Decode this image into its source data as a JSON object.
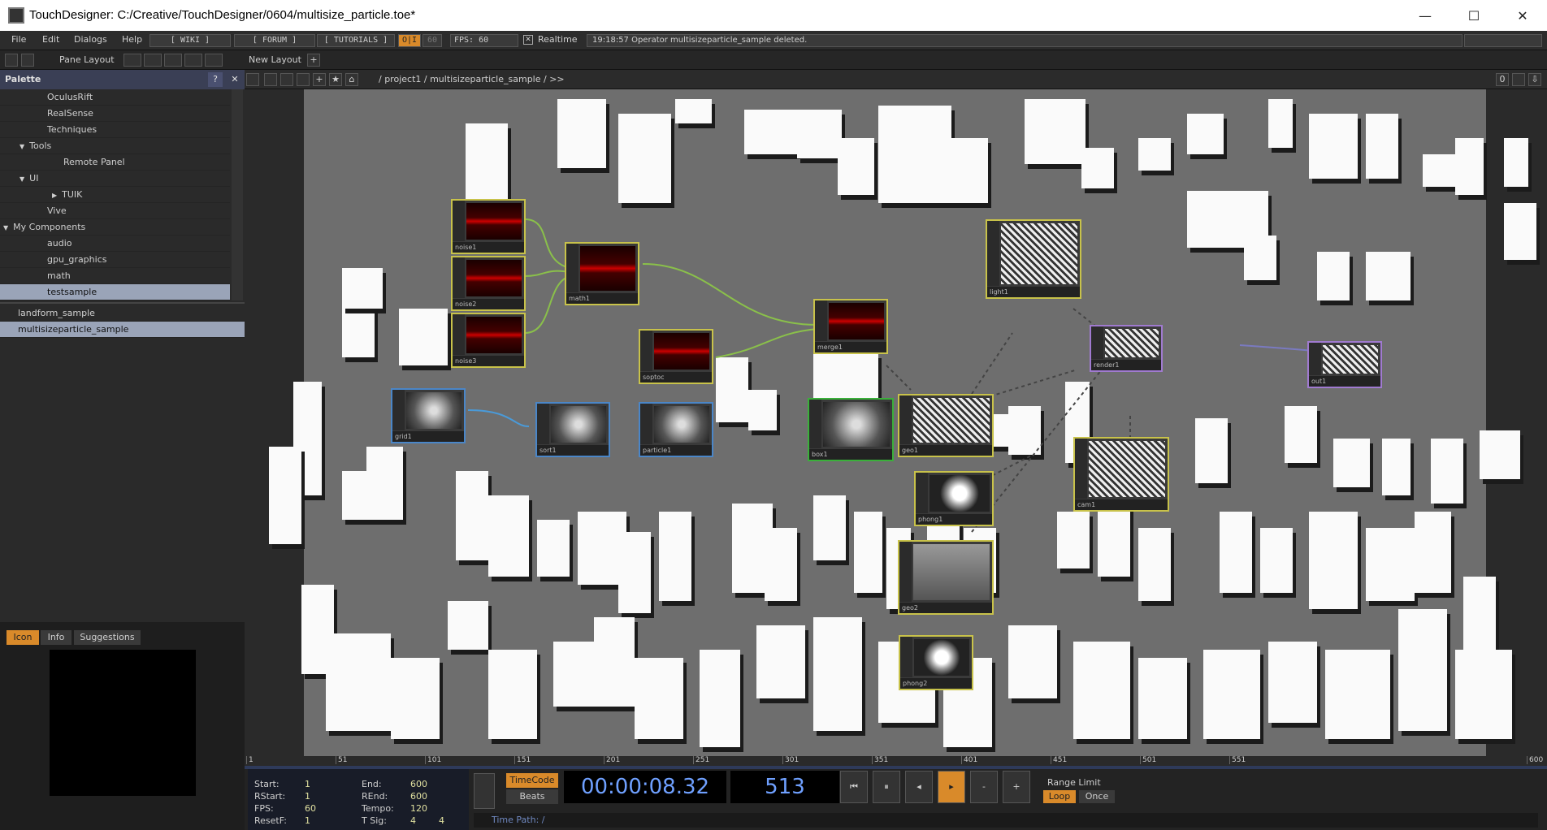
{
  "window": {
    "title": "TouchDesigner: C:/Creative/TouchDesigner/0604/multisize_particle.toe*",
    "minimize": "—",
    "maximize": "☐",
    "close": "✕"
  },
  "menu": {
    "items": [
      "File",
      "Edit",
      "Dialogs",
      "Help"
    ],
    "wiki": "[ WIKI ]",
    "forum": "[ FORUM ]",
    "tutorials": "[ TUTORIALS ]",
    "oi": "O|I",
    "fps_target": "60",
    "fps": "FPS:  60",
    "realtime": "Realtime",
    "status": "19:18:57 Operator multisizeparticle_sample deleted."
  },
  "toolbar": {
    "pane_layout": "Pane Layout",
    "new_layout": "New Layout"
  },
  "palette": {
    "title": "Palette",
    "help": "?",
    "close": "✕",
    "items": [
      {
        "label": "OculusRift",
        "indent": 2
      },
      {
        "label": "RealSense",
        "indent": 2
      },
      {
        "label": "Techniques",
        "indent": 2
      },
      {
        "label": "Tools",
        "indent": 1,
        "expand": "down"
      },
      {
        "label": "Remote Panel",
        "indent": 3
      },
      {
        "label": "UI",
        "indent": 1,
        "expand": "down"
      },
      {
        "label": "TUIK",
        "indent": 3,
        "expand": "right"
      },
      {
        "label": "Vive",
        "indent": 2
      },
      {
        "label": "My Components",
        "indent": 0,
        "expand": "down"
      },
      {
        "label": "audio",
        "indent": 2
      },
      {
        "label": "gpu_graphics",
        "indent": 2
      },
      {
        "label": "math",
        "indent": 2
      },
      {
        "label": "testsample",
        "indent": 2,
        "selected": true
      }
    ],
    "components": [
      "landform_sample",
      "multisizeparticle_sample"
    ],
    "tabs": [
      "Icon",
      "Info",
      "Suggestions"
    ]
  },
  "path": {
    "crumbs": "/ project1 / multisizeparticle_sample / >>",
    "zero": "0"
  },
  "nodes": [
    {
      "name": "noise1",
      "kind": "chop"
    },
    {
      "name": "noise2",
      "kind": "chop"
    },
    {
      "name": "noise3",
      "kind": "chop"
    },
    {
      "name": "math1",
      "kind": "chop"
    },
    {
      "name": "merge1",
      "kind": "chop"
    },
    {
      "name": "soptoc",
      "kind": "chop"
    },
    {
      "name": "grid1",
      "kind": "sop"
    },
    {
      "name": "sort1",
      "kind": "sop"
    },
    {
      "name": "particle1",
      "kind": "sop"
    },
    {
      "name": "box1",
      "kind": "sop"
    },
    {
      "name": "geo1",
      "kind": "comp"
    },
    {
      "name": "phong1",
      "kind": "mat"
    },
    {
      "name": "geo2",
      "kind": "comp"
    },
    {
      "name": "phong2",
      "kind": "mat"
    },
    {
      "name": "light1",
      "kind": "comp"
    },
    {
      "name": "render1",
      "kind": "top"
    },
    {
      "name": "cam1",
      "kind": "comp"
    },
    {
      "name": "out1",
      "kind": "top"
    }
  ],
  "timeline": {
    "ruler": [
      "1",
      "51",
      "101",
      "151",
      "201",
      "251",
      "301",
      "351",
      "401",
      "451",
      "501",
      "551",
      "600"
    ],
    "timecode_btn": "TimeCode",
    "beats_btn": "Beats",
    "timecode": "00:00:08.32",
    "frame": "513",
    "range_limit": "Range Limit",
    "loop": "Loop",
    "once": "Once",
    "time_path": "Time Path: /",
    "stats": {
      "start": "1",
      "end": "600",
      "rstart": "1",
      "rend": "600",
      "fps": "60",
      "tempo": "120",
      "resetf": "1",
      "tsig_a": "4",
      "tsig_b": "4"
    },
    "labels": {
      "start": "Start:",
      "end": "End:",
      "rstart": "RStart:",
      "rend": "REnd:",
      "fps": "FPS:",
      "tempo": "Tempo:",
      "resetf": "ResetF:",
      "tsig": "T Sig:"
    }
  },
  "colors": {
    "chop": "#c8c24a",
    "sop": "#4a86c8",
    "comp": "#c8c24a",
    "top": "#a07ad0",
    "mat": "#c8c24a",
    "accent": "#d98a2a"
  }
}
